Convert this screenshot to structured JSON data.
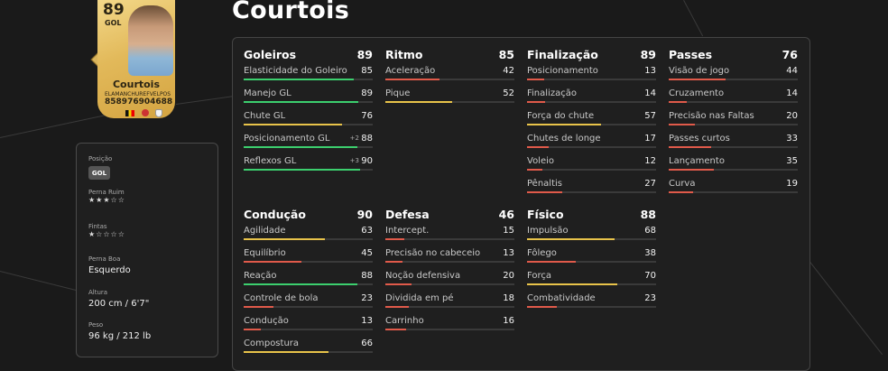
{
  "player": {
    "name": "Courtois",
    "card": {
      "rating": "89",
      "position": "GOL",
      "stat_labels": [
        "ELA",
        "MAN",
        "CHU",
        "REF",
        "VEL",
        "POS"
      ],
      "stat_values": [
        "85",
        "89",
        "76",
        "90",
        "46",
        "88"
      ]
    }
  },
  "info": {
    "position_label": "Posição",
    "position_value": "GOL",
    "weak_foot_label": "Perna Ruim",
    "weak_foot_stars": "★★★☆☆",
    "skills_label": "Fintas",
    "skills_stars": "★☆☆☆☆",
    "preferred_foot_label": "Perna Boa",
    "preferred_foot_value": "Esquerdo",
    "height_label": "Altura",
    "height_value": "200 cm / 6'7\"",
    "weight_label": "Peso",
    "weight_value": "96 kg / 212 lb"
  },
  "colors": {
    "high": "#3ccf6e",
    "mid": "#e8c34a",
    "low": "#e05a4a"
  },
  "stats": [
    {
      "name": "Goleiros",
      "value": "89",
      "items": [
        {
          "name": "Elasticidade do Goleiro",
          "value": "85"
        },
        {
          "name": "Manejo GL",
          "value": "89"
        },
        {
          "name": "Chute GL",
          "value": "76"
        },
        {
          "name": "Posicionamento GL",
          "value": "88",
          "delta": "+2"
        },
        {
          "name": "Reflexos GL",
          "value": "90",
          "delta": "+3"
        }
      ]
    },
    {
      "name": "Ritmo",
      "value": "85",
      "items": [
        {
          "name": "Aceleração",
          "value": "42"
        },
        {
          "name": "Pique",
          "value": "52"
        }
      ]
    },
    {
      "name": "Finalização",
      "value": "89",
      "items": [
        {
          "name": "Posicionamento",
          "value": "13"
        },
        {
          "name": "Finalização",
          "value": "14"
        },
        {
          "name": "Força do chute",
          "value": "57"
        },
        {
          "name": "Chutes de longe",
          "value": "17"
        },
        {
          "name": "Voleio",
          "value": "12"
        },
        {
          "name": "Pênaltis",
          "value": "27"
        }
      ]
    },
    {
      "name": "Passes",
      "value": "76",
      "items": [
        {
          "name": "Visão de jogo",
          "value": "44"
        },
        {
          "name": "Cruzamento",
          "value": "14"
        },
        {
          "name": "Precisão nas Faltas",
          "value": "20"
        },
        {
          "name": "Passes curtos",
          "value": "33"
        },
        {
          "name": "Lançamento",
          "value": "35"
        },
        {
          "name": "Curva",
          "value": "19"
        }
      ]
    },
    {
      "name": "Condução",
      "value": "90",
      "items": [
        {
          "name": "Agilidade",
          "value": "63"
        },
        {
          "name": "Equilíbrio",
          "value": "45"
        },
        {
          "name": "Reação",
          "value": "88"
        },
        {
          "name": "Controle de bola",
          "value": "23"
        },
        {
          "name": "Condução",
          "value": "13"
        },
        {
          "name": "Compostura",
          "value": "66"
        }
      ]
    },
    {
      "name": "Defesa",
      "value": "46",
      "items": [
        {
          "name": "Intercept.",
          "value": "15"
        },
        {
          "name": "Precisão no cabeceio",
          "value": "13"
        },
        {
          "name": "Noção defensiva",
          "value": "20"
        },
        {
          "name": "Dividida em pé",
          "value": "18"
        },
        {
          "name": "Carrinho",
          "value": "16"
        }
      ]
    },
    {
      "name": "Físico",
      "value": "88",
      "items": [
        {
          "name": "Impulsão",
          "value": "68"
        },
        {
          "name": "Fôlego",
          "value": "38"
        },
        {
          "name": "Força",
          "value": "70"
        },
        {
          "name": "Combatividade",
          "value": "23"
        }
      ]
    }
  ]
}
